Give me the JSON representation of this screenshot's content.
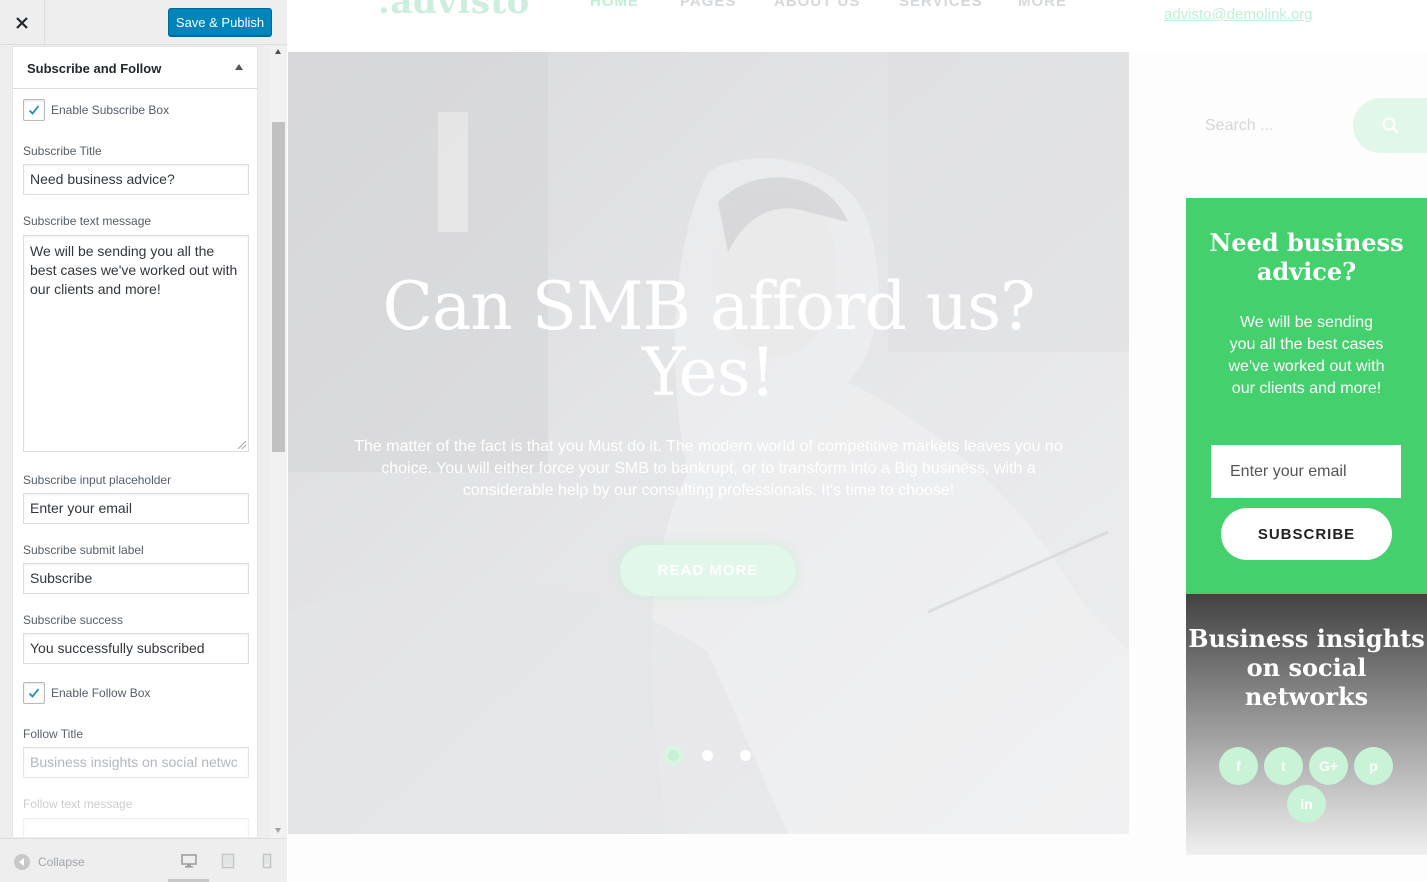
{
  "customizer": {
    "save_label": "Save & Publish",
    "section_title": "Subscribe and Follow",
    "enable_subscribe_label": "Enable Subscribe Box",
    "enable_subscribe_checked": true,
    "subscribe_title_label": "Subscribe Title",
    "subscribe_title_value": "Need business advice?",
    "subscribe_text_label": "Subscribe text message",
    "subscribe_text_value": "We will be sending you all the best cases we've worked out with our clients and more!",
    "placeholder_label": "Subscribe input placeholder",
    "placeholder_value": "Enter your email",
    "submit_label_label": "Subscribe submit label",
    "submit_label_value": "Subscribe",
    "success_label": "Subscribe success",
    "success_value": "You successfully subscribed",
    "enable_follow_label": "Enable Follow Box",
    "enable_follow_checked": true,
    "follow_title_label": "Follow Title",
    "follow_title_value": "Business insights on social netwc",
    "follow_text_label": "Follow text message",
    "collapse_label": "Collapse",
    "devices": [
      "desktop",
      "tablet",
      "mobile"
    ],
    "active_device": "desktop"
  },
  "site": {
    "logo": ".advisto",
    "nav": [
      "HOME",
      "PAGES",
      "ABOUT US",
      "SERVICES",
      "MORE"
    ],
    "active_nav": "HOME",
    "email": "advisto@demolink.org",
    "hero": {
      "title_line1": "Can SMB afford us?",
      "title_line2": "Yes!",
      "text": "The matter of the fact is that you Must do it. The modern world of competitive markets leaves you no choice. You will either force your SMB to bankrupt, or to transform into a Big business, with a considerable help by our consulting professionals. It's time to choose!",
      "button": "READ MORE",
      "slides": 3,
      "active_slide": 1
    },
    "search_placeholder": "Search ...",
    "subscribe": {
      "title": "Need business advice?",
      "text": "We will be sending you all the best cases we've worked out with our clients and more!",
      "placeholder": "Enter your email",
      "button": "SUBSCRIBE"
    },
    "follow": {
      "title": "Business in­sights on so­cial networks",
      "networks": [
        "f",
        "t",
        "G+",
        "p",
        "in"
      ]
    }
  },
  "colors": {
    "accent_green": "#45d06e",
    "wp_blue": "#0085ba",
    "follow_dark": "#424242"
  }
}
